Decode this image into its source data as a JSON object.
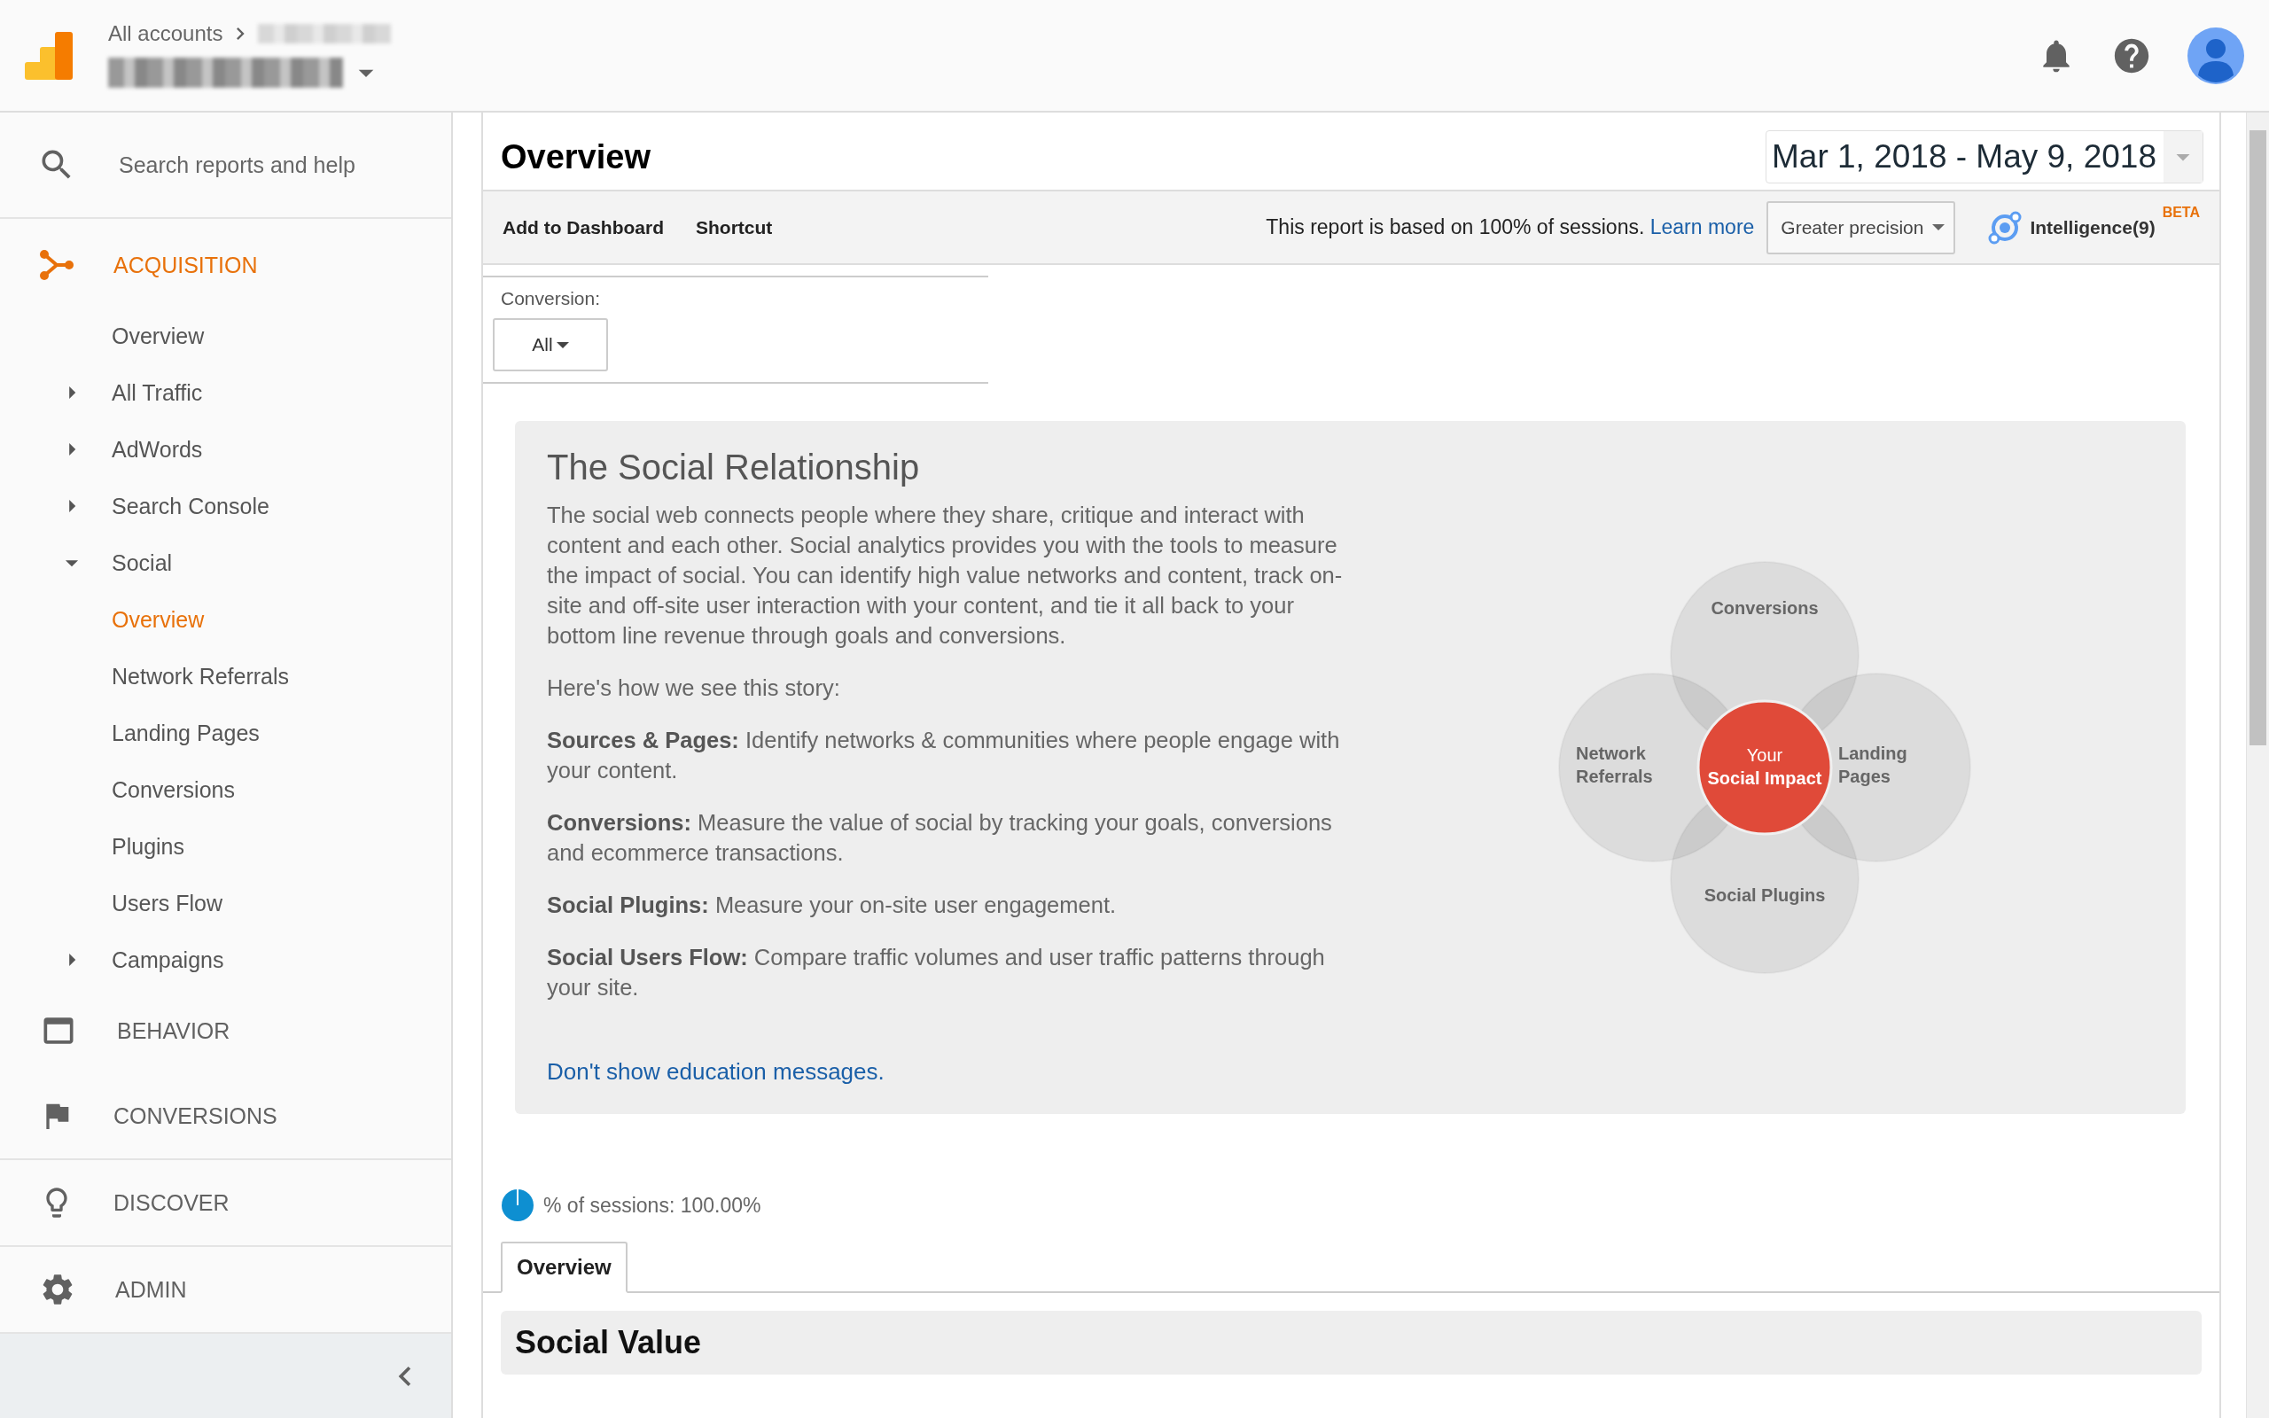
{
  "header": {
    "breadcrumb": "All accounts"
  },
  "search": {
    "placeholder": "Search reports and help"
  },
  "nav": {
    "sections": [
      {
        "kind": "acquisition",
        "label": "ACQUISITION",
        "selected": true,
        "items": [
          {
            "label": "Overview",
            "selected": false
          },
          {
            "label": "All Traffic",
            "selected": false,
            "expanded": false
          },
          {
            "label": "AdWords",
            "selected": false,
            "expanded": false
          },
          {
            "label": "Search Console",
            "selected": false,
            "expanded": false
          },
          {
            "label": "Social",
            "selected": false,
            "expanded": true,
            "children": [
              {
                "label": "Overview",
                "selected": true
              },
              {
                "label": "Network Referrals",
                "selected": false
              },
              {
                "label": "Landing Pages",
                "selected": false
              },
              {
                "label": "Conversions",
                "selected": false
              },
              {
                "label": "Plugins",
                "selected": false
              },
              {
                "label": "Users Flow",
                "selected": false
              }
            ]
          },
          {
            "label": "Campaigns",
            "selected": false,
            "expanded": false
          }
        ]
      },
      {
        "kind": "behavior",
        "label": "BEHAVIOR",
        "selected": false
      },
      {
        "kind": "conversions",
        "label": "CONVERSIONS",
        "selected": false
      }
    ],
    "tools": [
      {
        "kind": "discover",
        "label": "DISCOVER",
        "selected": false
      },
      {
        "kind": "admin",
        "label": "ADMIN",
        "selected": false
      }
    ]
  },
  "report": {
    "title": "Overview",
    "date_range": "Mar 1, 2018 - May 9, 2018",
    "actions": [
      "Add to Dashboard",
      "Shortcut"
    ],
    "sampling_note": "This report is based on 100% of sessions.",
    "learn_more": "Learn more",
    "precision": "Greater precision",
    "intelligence": "Intelligence(9)",
    "badge": "BETA"
  },
  "conversion": {
    "label": "Conversion:",
    "value": "All"
  },
  "education": {
    "title": "The Social Relationship",
    "paragraphs": [
      "The social web connects people where they share, critique and interact with content and each other. Social analytics provides you with the tools to measure the impact of social. You can identify high value networks and content, track on-site and off-site user interaction with your content, and tie it all back to your bottom line revenue through goals and conversions.",
      "Here's how we see this story:",
      "**Sources & Pages:** Identify networks & communities where people engage with your content.",
      "**Conversions:** Measure the value of social by tracking your goals, conversions and ecommerce transactions.",
      "**Social Plugins:** Measure your on-site user engagement.",
      "**Social Users Flow:** Compare traffic volumes and user traffic patterns through your site."
    ],
    "link": "Don't show education messages.",
    "diagram": {
      "labels": [
        {
          "kind": "top",
          "lines": [
            "Conversions"
          ]
        },
        {
          "kind": "left",
          "lines": [
            "Network",
            "Referrals"
          ]
        },
        {
          "kind": "right",
          "lines": [
            "Landing",
            "Pages"
          ]
        },
        {
          "kind": "bottom",
          "lines": [
            "Social Plugins"
          ]
        }
      ],
      "center": {
        "caption": "Your",
        "title": "Social Impact"
      }
    }
  },
  "sessions": {
    "text": "% of sessions: 100.00%"
  },
  "tabs": [
    {
      "label": "Overview",
      "selected": true
    }
  ],
  "section_title": "Social Value"
}
